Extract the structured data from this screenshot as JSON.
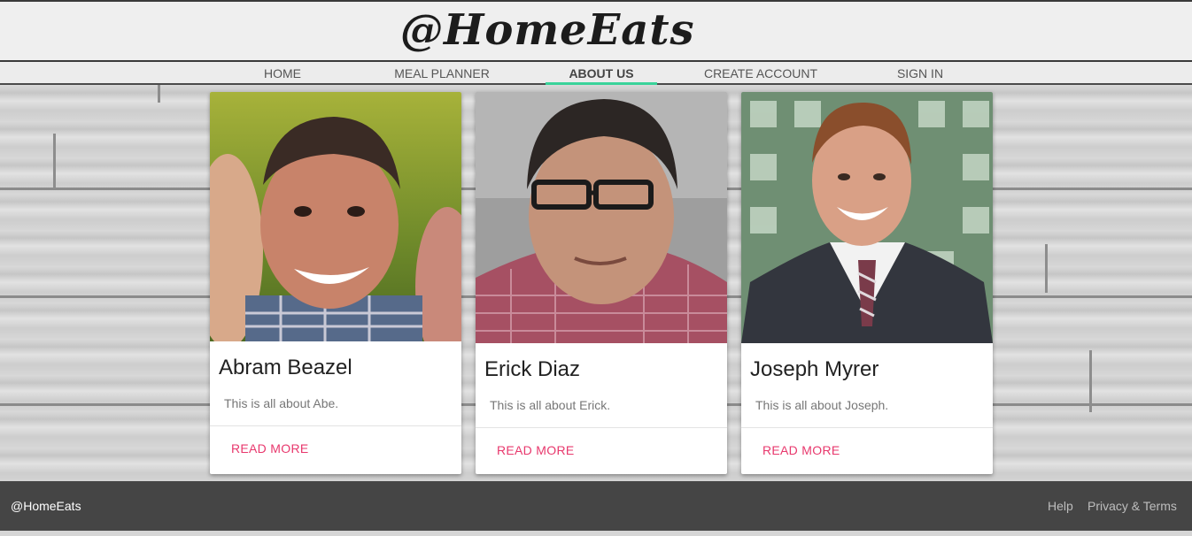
{
  "header": {
    "logo_text": "@HomeEats"
  },
  "nav": {
    "items": [
      {
        "label": "HOME"
      },
      {
        "label": "MEAL PLANNER"
      },
      {
        "label": "ABOUT US"
      },
      {
        "label": "CREATE ACCOUNT"
      },
      {
        "label": "SIGN IN"
      }
    ],
    "active": "ABOUT US",
    "active_color": "#3ad39a"
  },
  "cards": [
    {
      "name": "Abram Beazel",
      "text": "This is all about Abe.",
      "link": "READ MORE"
    },
    {
      "name": "Erick Diaz",
      "text": "This is all about Erick.",
      "link": "READ MORE"
    },
    {
      "name": "Joseph Myrer",
      "text": "This is all about Joseph.",
      "link": "READ MORE"
    }
  ],
  "link_color": "#e8386d",
  "footer": {
    "brand": "@HomeEats",
    "help": "Help",
    "privacy": "Privacy & Terms"
  }
}
